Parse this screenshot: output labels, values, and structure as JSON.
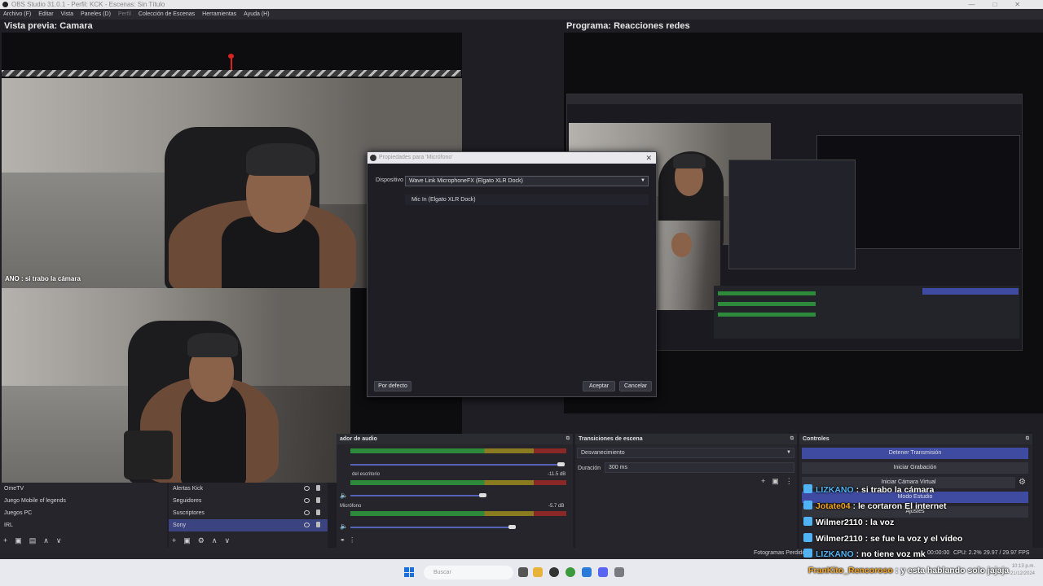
{
  "window": {
    "title": "OBS Studio 31.0.1 - Perfil: KCK - Escenas: Sin Título"
  },
  "menu": [
    "Archivo (F)",
    "Editar",
    "Vista",
    "Paneles (D)",
    "Perfil",
    "Colección de Escenas",
    "Herramientas",
    "Ayuda (H)"
  ],
  "preview": {
    "left_label": "Vista previa: Camara",
    "right_label": "Programa: Reacciones redes"
  },
  "cam_overlay_chat": "ANO : si trabo la cámara",
  "dialog": {
    "title": "Propiedades para 'Micrófono'",
    "device_label": "Dispositivo",
    "device_value": "Wave Link MicrophoneFX (Elgato XLR Dock)",
    "option": "Mic In (Elgato XLR Dock)",
    "defaults_btn": "Por defecto",
    "accept_btn": "Aceptar",
    "cancel_btn": "Cancelar"
  },
  "scenes": [
    "OmeTV",
    "Juego Mobile of legends",
    "Juegos PC",
    "IRL"
  ],
  "sources": [
    {
      "name": "Alertas Kick",
      "selected": false
    },
    {
      "name": "Seguidores",
      "selected": false
    },
    {
      "name": "Suscriptores",
      "selected": false
    },
    {
      "name": "Sony",
      "selected": true
    }
  ],
  "mixer": {
    "title": "ador de audio",
    "ticks": [
      "-60",
      "-55",
      "-50",
      "-45",
      "-40",
      "-35",
      "-30",
      "-25",
      "-20",
      "-15",
      "-10",
      "-5",
      "0"
    ],
    "channels": [
      {
        "name": "",
        "db": ""
      },
      {
        "name": "del escritorio",
        "db": "-11.5 dB"
      },
      {
        "name": "Micrófono",
        "db": "-5.7 dB"
      }
    ]
  },
  "transitions": {
    "title": "Transiciones de escena",
    "type": "Desvanecimiento",
    "duration_label": "Duración",
    "duration": "300 ms"
  },
  "controls": {
    "title": "Controles",
    "buttons": [
      "Detener Transmisión",
      "Iniciar Grabación",
      "Iniciar Cámara Virtual",
      "Modo Estudio",
      "Ajustes"
    ]
  },
  "chat": [
    {
      "user": "LIZKANO",
      "msg": " : si trabo la cámara",
      "color": "#4fb3f5"
    },
    {
      "user": "Jotate04",
      "msg": " : le cortaron El internet",
      "color": "#f5a623"
    },
    {
      "user": "Wilmer2110",
      "msg": " : la voz",
      "color": "#ffffff"
    },
    {
      "user": "Wilmer2110",
      "msg": " : se fue la voz y el vídeo",
      "color": "#ffffff"
    },
    {
      "user": "LIZKANO",
      "msg": " : no tiene voz mk",
      "color": "#4fb3f5"
    }
  ],
  "chat_bottom": {
    "user": "FranKito_Rencoroso",
    "msg": " : y esta hablando solo jajaja",
    "color": "#f5a623"
  },
  "status": {
    "dropped": "Fotogramas Perdidos",
    "time": "00:00:00",
    "cpu": "CPU: 2.2%",
    "fps": "29.97 / 29.97 FPS"
  },
  "taskbar": {
    "search": "Buscar",
    "clock": "10:13 p.m.",
    "date": "21/12/2024"
  },
  "colors": {
    "accent": "#3f4ba0",
    "bg": "#1f1e24"
  }
}
